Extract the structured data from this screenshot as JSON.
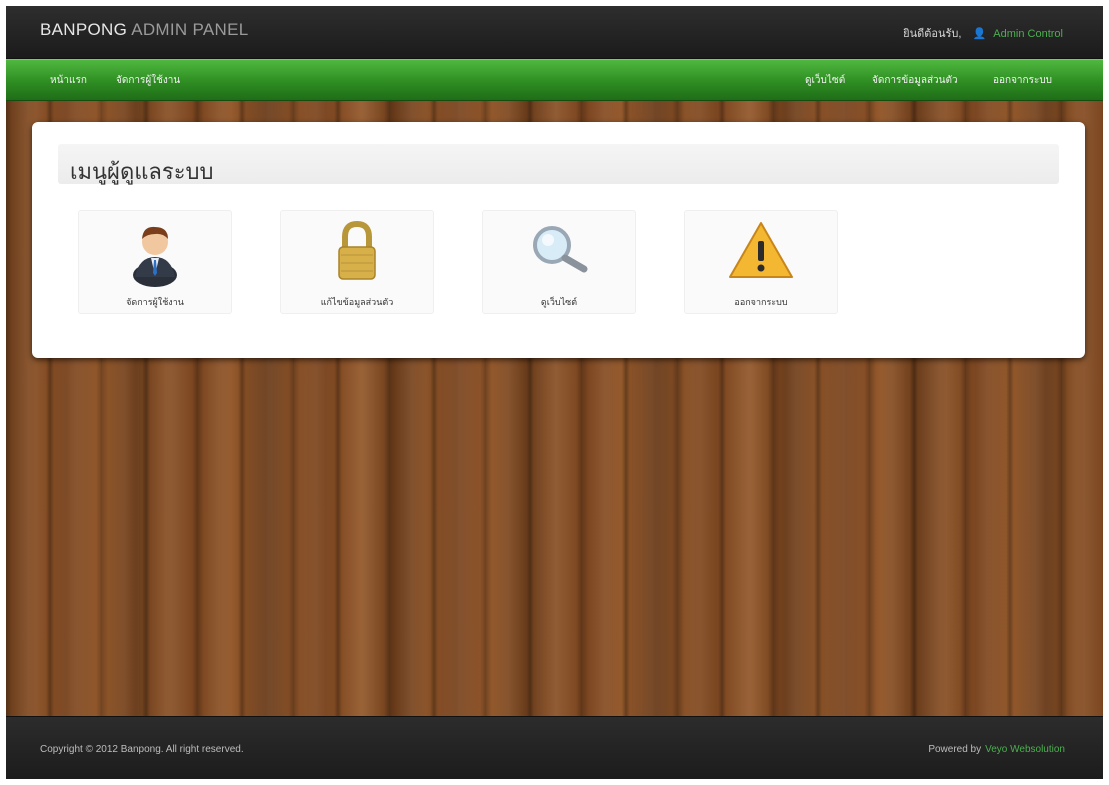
{
  "header": {
    "brand_strong": "BANPONG",
    "brand_light": " ADMIN PANEL",
    "welcome_text": "ยินดีต้อนรับ,",
    "user_icon": "user-icon",
    "admin_link": "Admin Control"
  },
  "nav": {
    "left": [
      "หน้าแรก",
      "จัดการผู้ใช้งาน"
    ],
    "right": [
      "ดูเว็บไซต์",
      "จัดการข้อมูลส่วนตัว",
      "ออกจากระบบ"
    ]
  },
  "panel": {
    "title": "เมนูผู้ดูแลระบบ",
    "tiles": [
      {
        "label": "จัดการผู้ใช้งาน",
        "icon": "admin-user-icon"
      },
      {
        "label": "แก้ไขข้อมูลส่วนตัว",
        "icon": "lock-icon"
      },
      {
        "label": "ดูเว็บไซต์",
        "icon": "magnifier-icon"
      },
      {
        "label": "ออกจากระบบ",
        "icon": "warning-icon"
      }
    ]
  },
  "footer": {
    "copyright": "Copyright © 2012 Banpong. All right reserved.",
    "powered_prefix": "Powered by",
    "powered_brand": "Veyo Websolution"
  },
  "colors": {
    "accent_green": "#2e8d22",
    "topbar_dark": "#1b1b1b",
    "wood_brown": "#7a4520"
  }
}
